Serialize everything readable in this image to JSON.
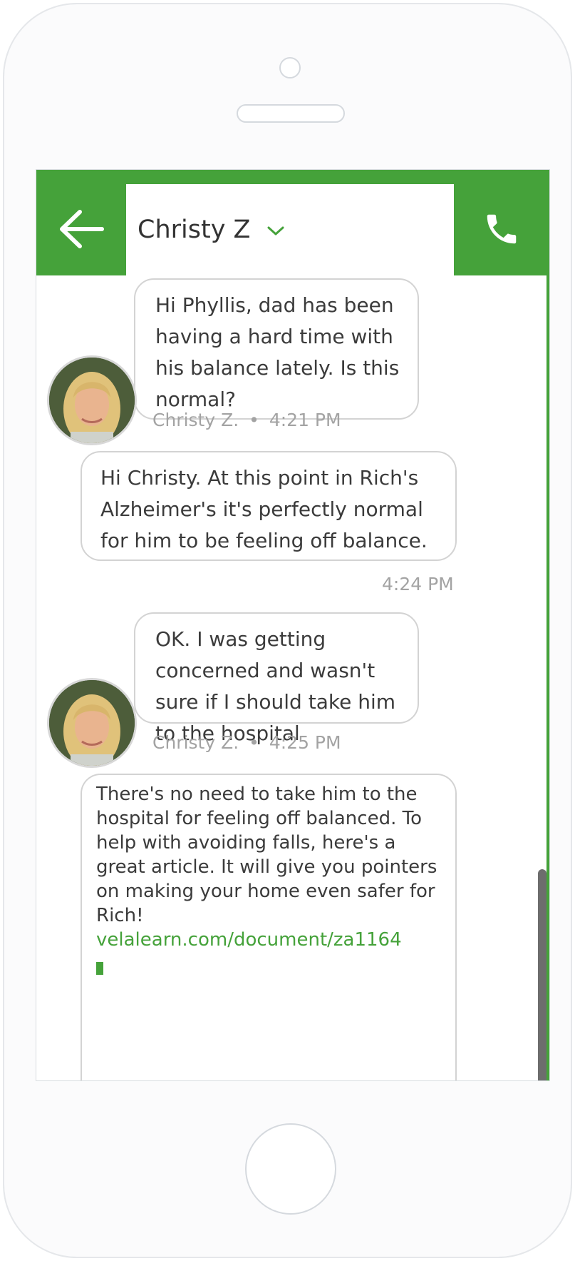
{
  "header": {
    "contact_name": "Christy Z",
    "back_icon": "arrow-left-icon",
    "dropdown_icon": "chevron-down-icon",
    "call_icon": "phone-icon"
  },
  "colors": {
    "brand_green": "#45a23a",
    "bubble_border": "#d3d3d3",
    "meta_text": "#a3a3a3"
  },
  "messages": [
    {
      "from": "contact",
      "text": "Hi Phyllis, dad has been having a hard time with his balance lately. Is this normal?",
      "sender": "Christy Z.",
      "separator": "•",
      "time": "4:21 PM"
    },
    {
      "from": "me",
      "text": "Hi Christy. At this point in Rich's Alzheimer's it's perfectly normal for him to be feeling off balance.",
      "time": "4:24 PM"
    },
    {
      "from": "contact",
      "text": "OK. I was getting concerned and wasn't sure if I should take him to the hospital",
      "sender": "Christy Z.",
      "separator": "•",
      "time": "4:25 PM"
    },
    {
      "from": "me",
      "text": "There's no need to take him to the hospital for feeling off balanced. To help with avoiding falls, here's a great article. It will give you pointers on making your home even safer for Rich!",
      "link": "velalearn.com/document/za1164"
    }
  ]
}
